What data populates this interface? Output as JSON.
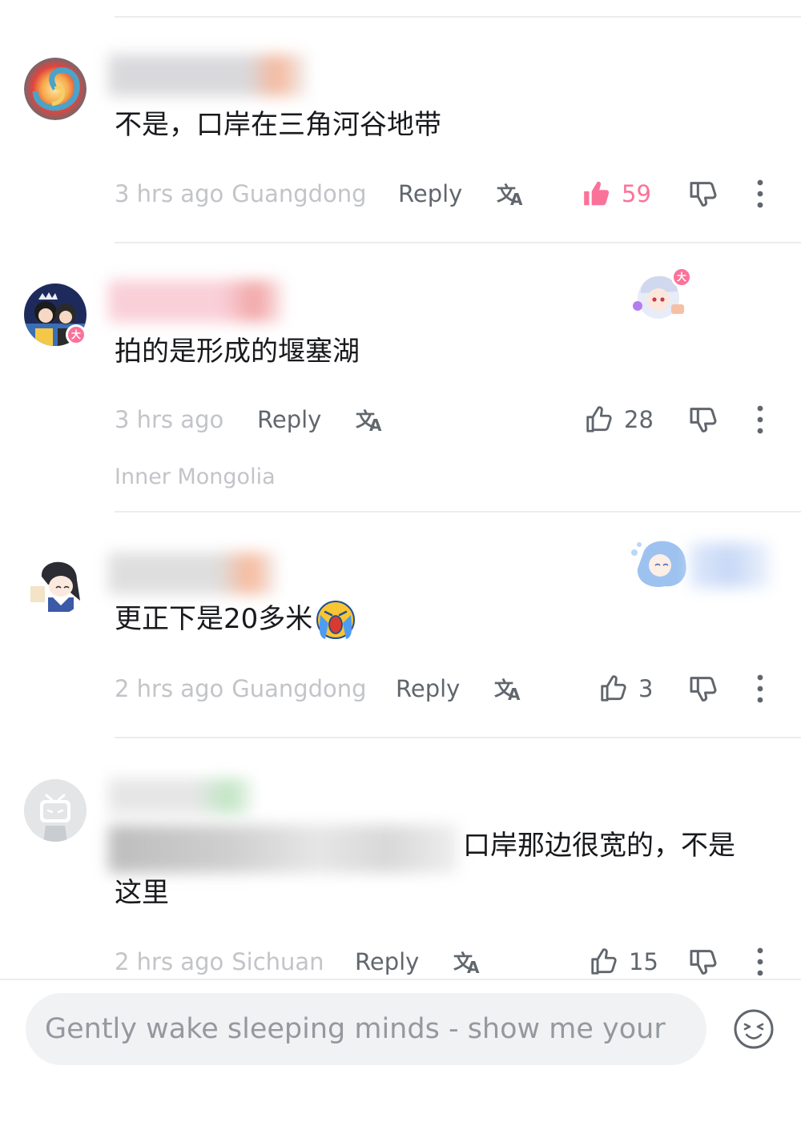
{
  "comments": [
    {
      "text": "不是，口岸在三角河谷地带",
      "time": "3 hrs ago",
      "location": "Guangdong",
      "reply_label": "Reply",
      "likes": "59",
      "liked": true
    },
    {
      "text": "拍的是形成的堰塞湖",
      "time": "3 hrs ago",
      "location": "Inner Mongolia",
      "reply_label": "Reply",
      "likes": "28",
      "liked": false,
      "avatar_badge": "大",
      "decor_badge": "大"
    },
    {
      "text": "更正下是20多米",
      "emoji": "😭",
      "time": "2 hrs ago",
      "location": "Guangdong",
      "reply_label": "Reply",
      "likes": "3",
      "liked": false
    },
    {
      "text_line1": "口岸那边很宽的，不是",
      "text_line2": "这里",
      "time": "2 hrs ago",
      "location": "Sichuan",
      "reply_label": "Reply",
      "likes": "15",
      "liked": false
    }
  ],
  "composer": {
    "placeholder": "Gently wake sleeping minds - show me your"
  },
  "colors": {
    "accent_pink": "#fb7299",
    "meta_gray": "#c2c4c8",
    "secondary_text": "#61666d",
    "divider": "#ebecef"
  }
}
